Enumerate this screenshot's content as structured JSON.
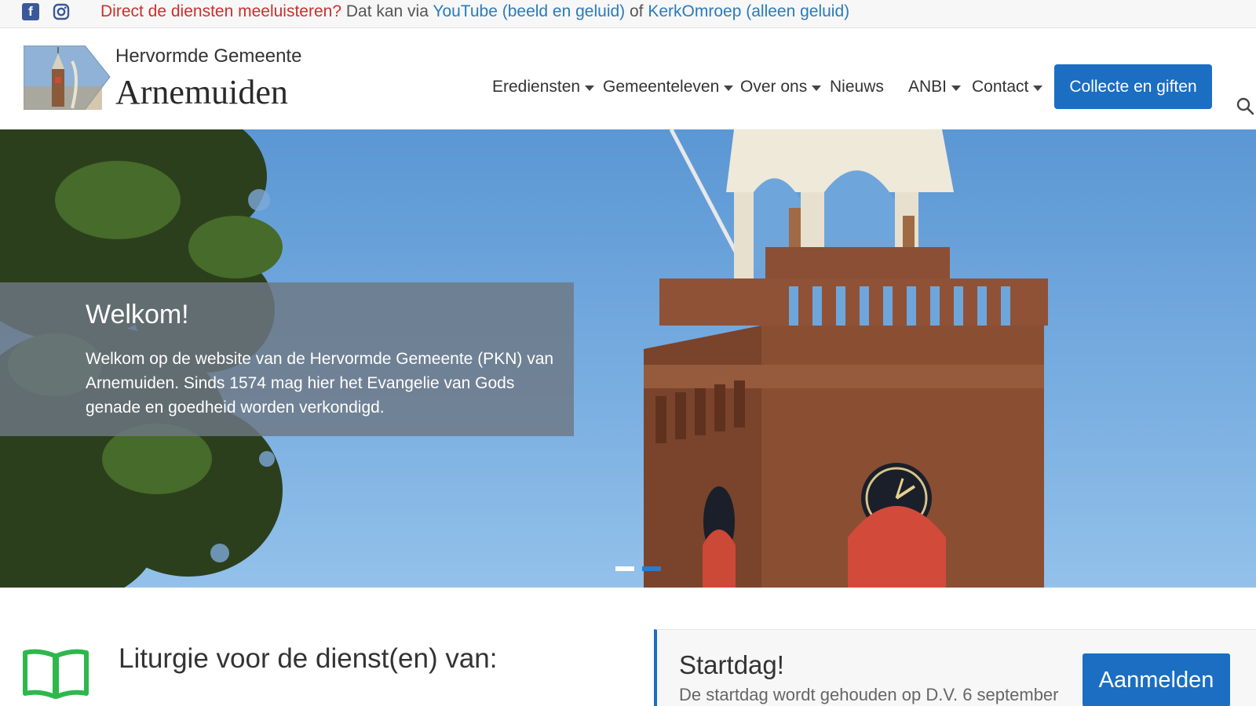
{
  "topbar": {
    "social_icons": [
      "facebook-icon",
      "instagram-icon"
    ],
    "announce_red": "Direct de diensten meeluisteren?",
    "announce_text": " Dat kan via ",
    "link_youtube": "YouTube (beeld en geluid)",
    "announce_or": " of ",
    "link_kerkomroep": "KerkOmroep (alleen geluid)"
  },
  "header": {
    "logo_small": "Hervormde Gemeente",
    "logo_big": "Arnemuiden",
    "nav": [
      {
        "label": "Erediensten",
        "dropdown": true
      },
      {
        "label": "Gemeenteleven",
        "dropdown": true
      },
      {
        "label": "Over ons",
        "dropdown": true
      },
      {
        "label": "Nieuws",
        "dropdown": false
      },
      {
        "label": "ANBI",
        "dropdown": true
      },
      {
        "label": "Contact",
        "dropdown": true
      }
    ],
    "cta_label": "Collecte en giften",
    "search_icon": "search-icon"
  },
  "hero": {
    "title": "Welkom!",
    "text": "Welkom op de website van de Hervormde Gemeente (PKN) van Arnemuiden. Sinds 1574 mag hier het Evangelie van Gods genade en goedheid worden verkondigd.",
    "slides": 2,
    "active_slide": 2
  },
  "liturgy": {
    "icon": "book-icon",
    "title": "Liturgie voor de dienst(en) van:"
  },
  "startdag": {
    "title": "Startdag!",
    "subtitle": "De startdag wordt gehouden op D.V. 6 september",
    "button": "Aanmelden"
  },
  "colors": {
    "brand_blue": "#1b6ec2",
    "announce_red": "#c9302c",
    "link_blue": "#2b7bb9",
    "book_green": "#2db84b"
  }
}
